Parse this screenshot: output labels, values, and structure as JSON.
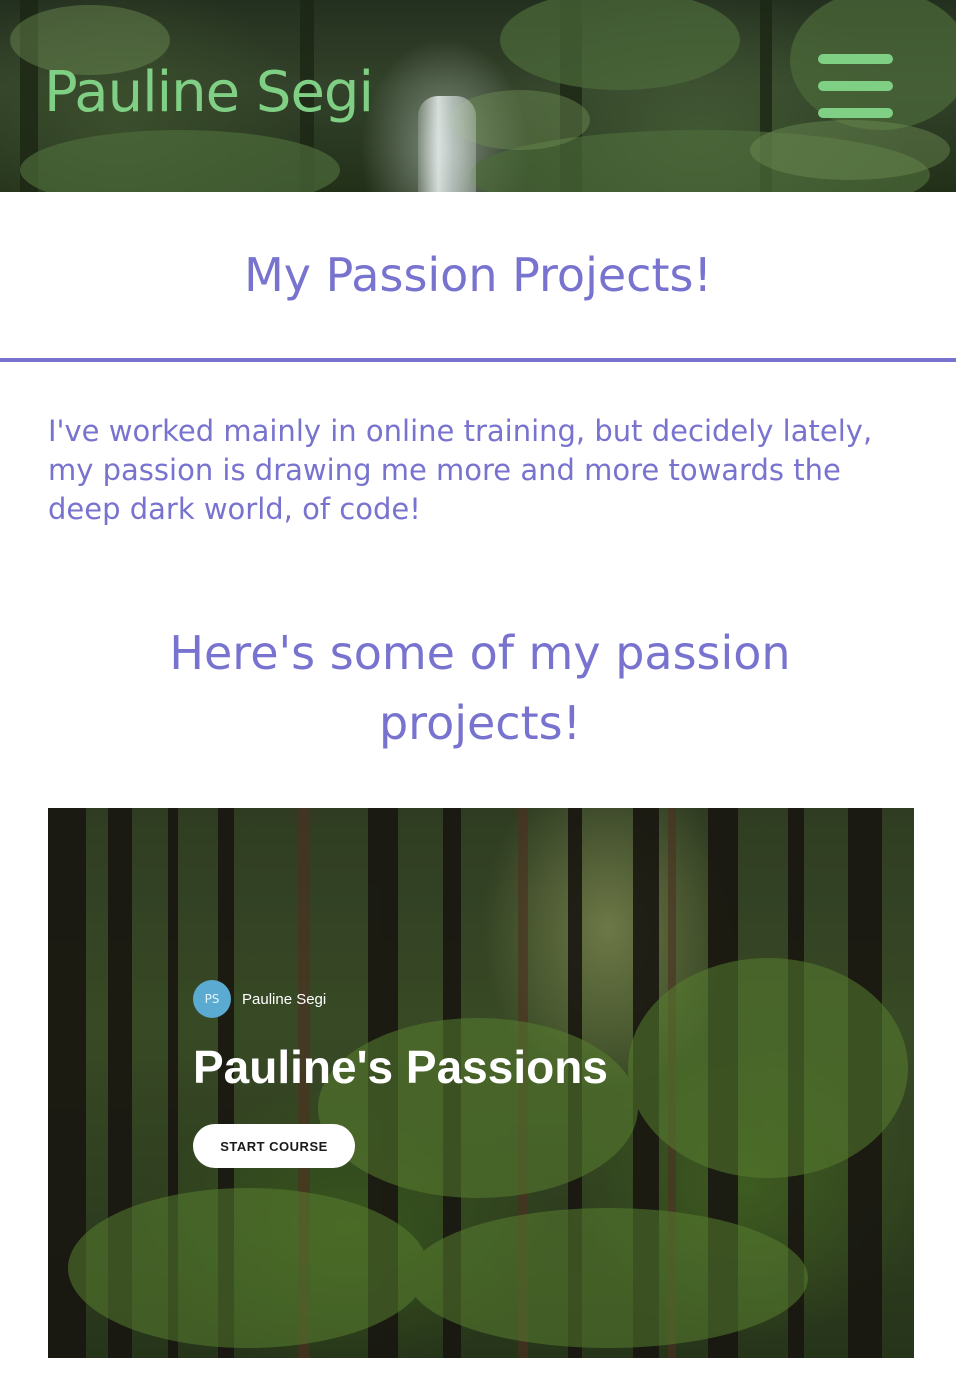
{
  "header": {
    "site_title": "Pauline Segi",
    "menu_icon": "hamburger-menu-icon",
    "accent_color": "#7fcf84"
  },
  "main": {
    "heading": "My Passion Projects!",
    "intro": "I've worked mainly in online training, but decidely lately, my passion is drawing me more and more towards the deep dark world, of code!",
    "subheading": "Here's some of my passion projects!",
    "text_color": "#7873cf"
  },
  "course_card": {
    "avatar_initials": "PS",
    "avatar_color": "#5aaad1",
    "author_name": "Pauline Segi",
    "title": "Pauline's Passions",
    "start_button": "START COURSE"
  }
}
